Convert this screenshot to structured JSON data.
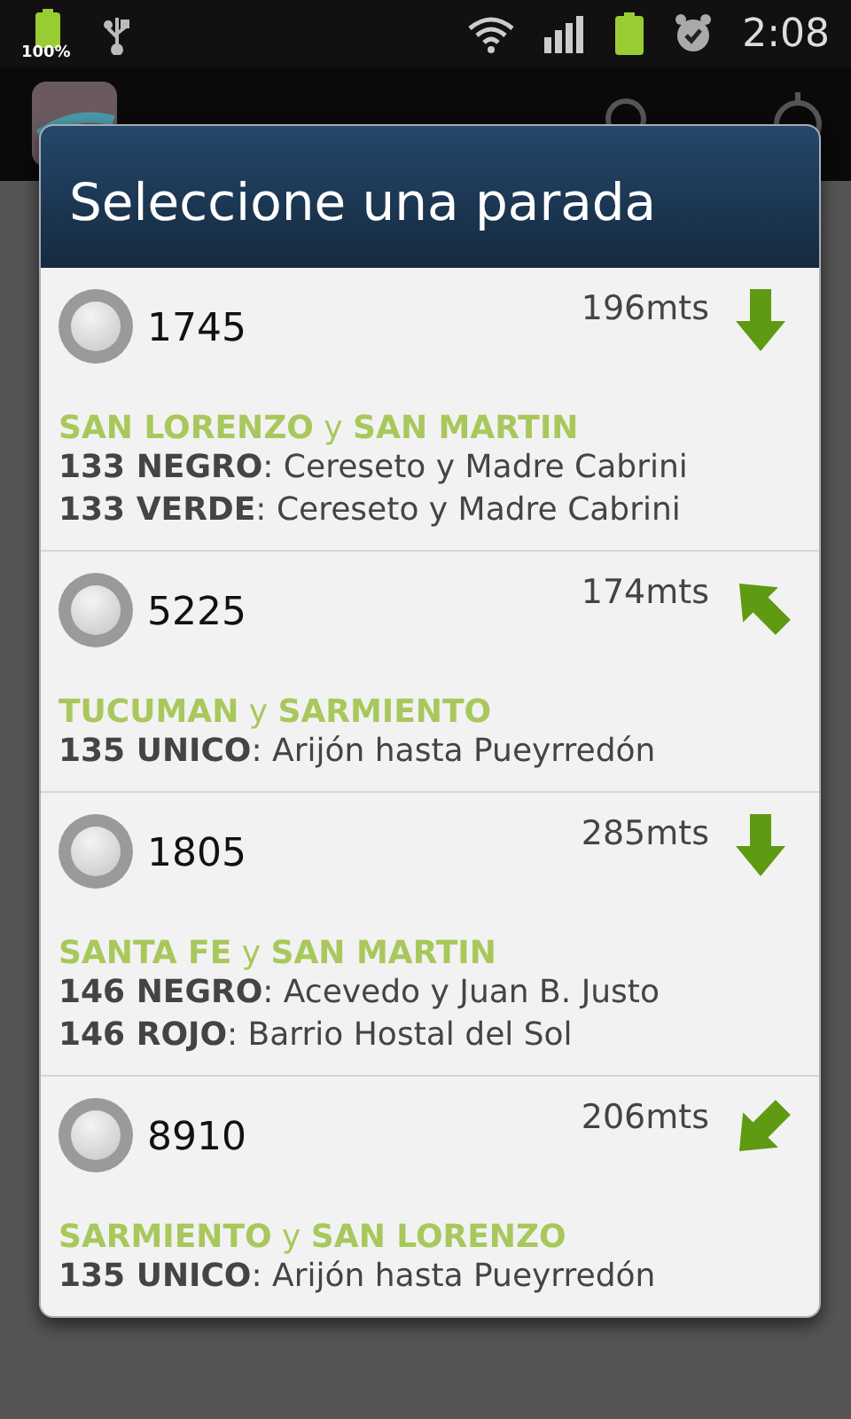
{
  "status_bar": {
    "battery_label": "100%",
    "time": "2:08"
  },
  "dialog": {
    "title": "Seleccione una parada",
    "stops": [
      {
        "number": "1745",
        "selected": false,
        "distance": "196mts",
        "kind": "south",
        "intersection": "**SAN LORENZO** y **SAN MARTIN**",
        "lines": [
          "**133 NEGRO**: Cereseto y Madre Cabrini",
          "**133 VERDE**: Cereseto y Madre Cabrini"
        ]
      },
      {
        "number": "5225",
        "selected": false,
        "distance": "174mts",
        "kind": "northwest",
        "intersection": "**TUCUMAN** y **SARMIENTO**",
        "lines": [
          "**135 UNICO**: Arijón hasta Pueyrredón"
        ]
      },
      {
        "number": "1805",
        "selected": false,
        "distance": "285mts",
        "kind": "south",
        "intersection": "**SANTA FE** y **SAN MARTIN**",
        "lines": [
          "**146 NEGRO**: Acevedo y Juan B. Justo",
          "**146 ROJO**: Barrio Hostal del Sol"
        ]
      },
      {
        "number": "8910",
        "selected": false,
        "distance": "206mts",
        "kind": "southwest",
        "intersection": "**SARMIENTO** y **SAN LORENZO**",
        "lines": [
          "**135 UNICO**: Arijón hasta Pueyrredón"
        ]
      }
    ]
  }
}
